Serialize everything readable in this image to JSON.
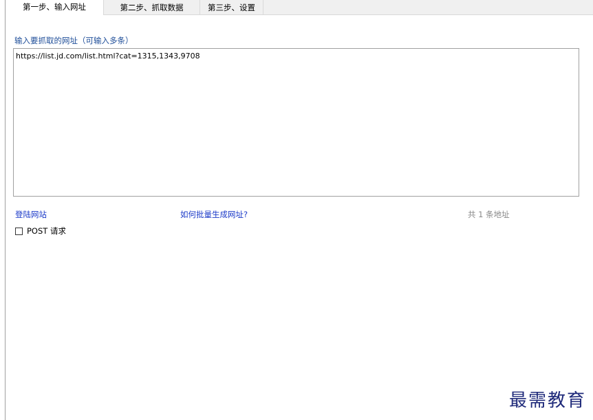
{
  "tabs": [
    {
      "label": "第一步、输入网址",
      "active": true
    },
    {
      "label": "第二步、抓取数据",
      "active": false
    },
    {
      "label": "第三步、设置",
      "active": false
    }
  ],
  "url_section": {
    "label": "输入要抓取的网址（可输入多条）",
    "value": "https://list.jd.com/list.html?cat=1315,1343,9708"
  },
  "links": {
    "login": "登陆网站",
    "batch": "如何批量生成网址?"
  },
  "count_text": "共 1 条地址",
  "post": {
    "label": "POST 请求",
    "checked": false
  },
  "watermark": "最需教育",
  "colors": {
    "link": "#1a39c8",
    "section_label": "#1f4e99",
    "watermark": "#1f2a7a"
  }
}
